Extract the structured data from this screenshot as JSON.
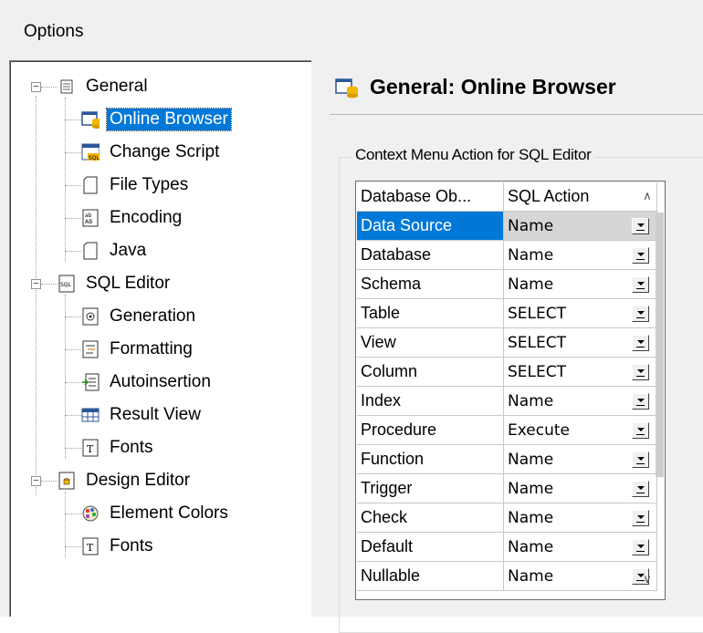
{
  "window": {
    "title": "Options"
  },
  "tree": {
    "general": "General",
    "online_browser": "Online Browser",
    "change_script": "Change Script",
    "file_types": "File Types",
    "encoding": "Encoding",
    "java": "Java",
    "sql_editor": "SQL Editor",
    "generation": "Generation",
    "formatting": "Formatting",
    "autoinsertion": "Autoinsertion",
    "result_view": "Result View",
    "fonts": "Fonts",
    "design_editor": "Design Editor",
    "element_colors": "Element Colors",
    "design_fonts": "Fonts",
    "expander_minus": "−"
  },
  "page": {
    "heading": "General: Online Browser",
    "group_label": "Context Menu Action for SQL Editor"
  },
  "grid": {
    "headers": [
      "Database Ob...",
      "SQL Action"
    ],
    "rows": [
      {
        "object": "Data Source",
        "action": "Name"
      },
      {
        "object": "Database",
        "action": "Name"
      },
      {
        "object": "Schema",
        "action": "Name"
      },
      {
        "object": "Table",
        "action": "SELECT"
      },
      {
        "object": "View",
        "action": "SELECT"
      },
      {
        "object": "Column",
        "action": "SELECT"
      },
      {
        "object": "Index",
        "action": "Name"
      },
      {
        "object": "Procedure",
        "action": "Execute"
      },
      {
        "object": "Function",
        "action": "Name"
      },
      {
        "object": "Trigger",
        "action": "Name"
      },
      {
        "object": "Check",
        "action": "Name"
      },
      {
        "object": "Default",
        "action": "Name"
      },
      {
        "object": "Nullable",
        "action": "Name"
      }
    ],
    "scroll_up": "∧",
    "scroll_down": "∨"
  },
  "colors": {
    "selection": "#0078d7",
    "panel_bg": "#f0f0f0"
  }
}
